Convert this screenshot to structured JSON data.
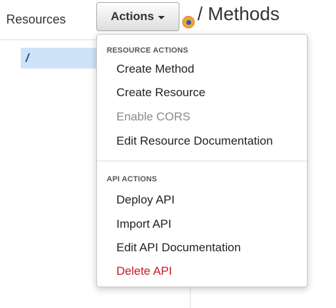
{
  "sidebar": {
    "title": "Resources",
    "items": [
      {
        "label": "/"
      }
    ]
  },
  "toolbar": {
    "actions_label": "Actions"
  },
  "header": {
    "title": "/ Methods"
  },
  "dropdown": {
    "sections": [
      {
        "title": "RESOURCE ACTIONS",
        "items": [
          {
            "label": "Create Method",
            "state": "enabled"
          },
          {
            "label": "Create Resource",
            "state": "enabled"
          },
          {
            "label": "Enable CORS",
            "state": "disabled"
          },
          {
            "label": "Edit Resource Documentation",
            "state": "enabled"
          }
        ]
      },
      {
        "title": "API ACTIONS",
        "items": [
          {
            "label": "Deploy API",
            "state": "enabled"
          },
          {
            "label": "Import API",
            "state": "enabled"
          },
          {
            "label": "Edit API Documentation",
            "state": "enabled"
          },
          {
            "label": "Delete API",
            "state": "danger"
          }
        ]
      }
    ]
  },
  "colors": {
    "selected_bg": "#cfe3f8",
    "danger": "#c71c22",
    "disabled": "#8a8a8a",
    "indicator": "#f2a33a"
  }
}
